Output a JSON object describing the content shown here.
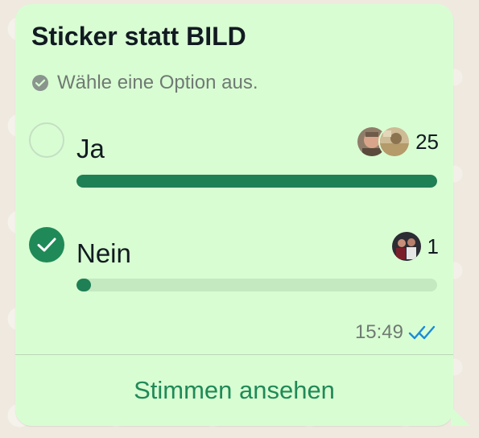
{
  "poll": {
    "title": "Sticker statt BILD",
    "subtitle": "Wähle eine Option aus.",
    "options": [
      {
        "label": "Ja",
        "votes": "25",
        "vote_fraction": 1.0,
        "selected": false,
        "voter_avatars": [
          "avatar-man-face",
          "avatar-landscape"
        ]
      },
      {
        "label": "Nein",
        "votes": "1",
        "vote_fraction": 0.04,
        "selected": true,
        "voter_avatars": [
          "avatar-group-photo"
        ]
      }
    ],
    "time": "15:49",
    "read_status_icon": "double-check-icon",
    "view_votes_label": "Stimmen ansehen"
  },
  "colors": {
    "bubble_bg": "#d9fdd3",
    "accent_green": "#1f8a57",
    "bar_fill": "#1f7f55",
    "bar_track": "#c4e8c0",
    "read_check_blue": "#1a8cd8",
    "muted_text": "#6f7a73"
  }
}
